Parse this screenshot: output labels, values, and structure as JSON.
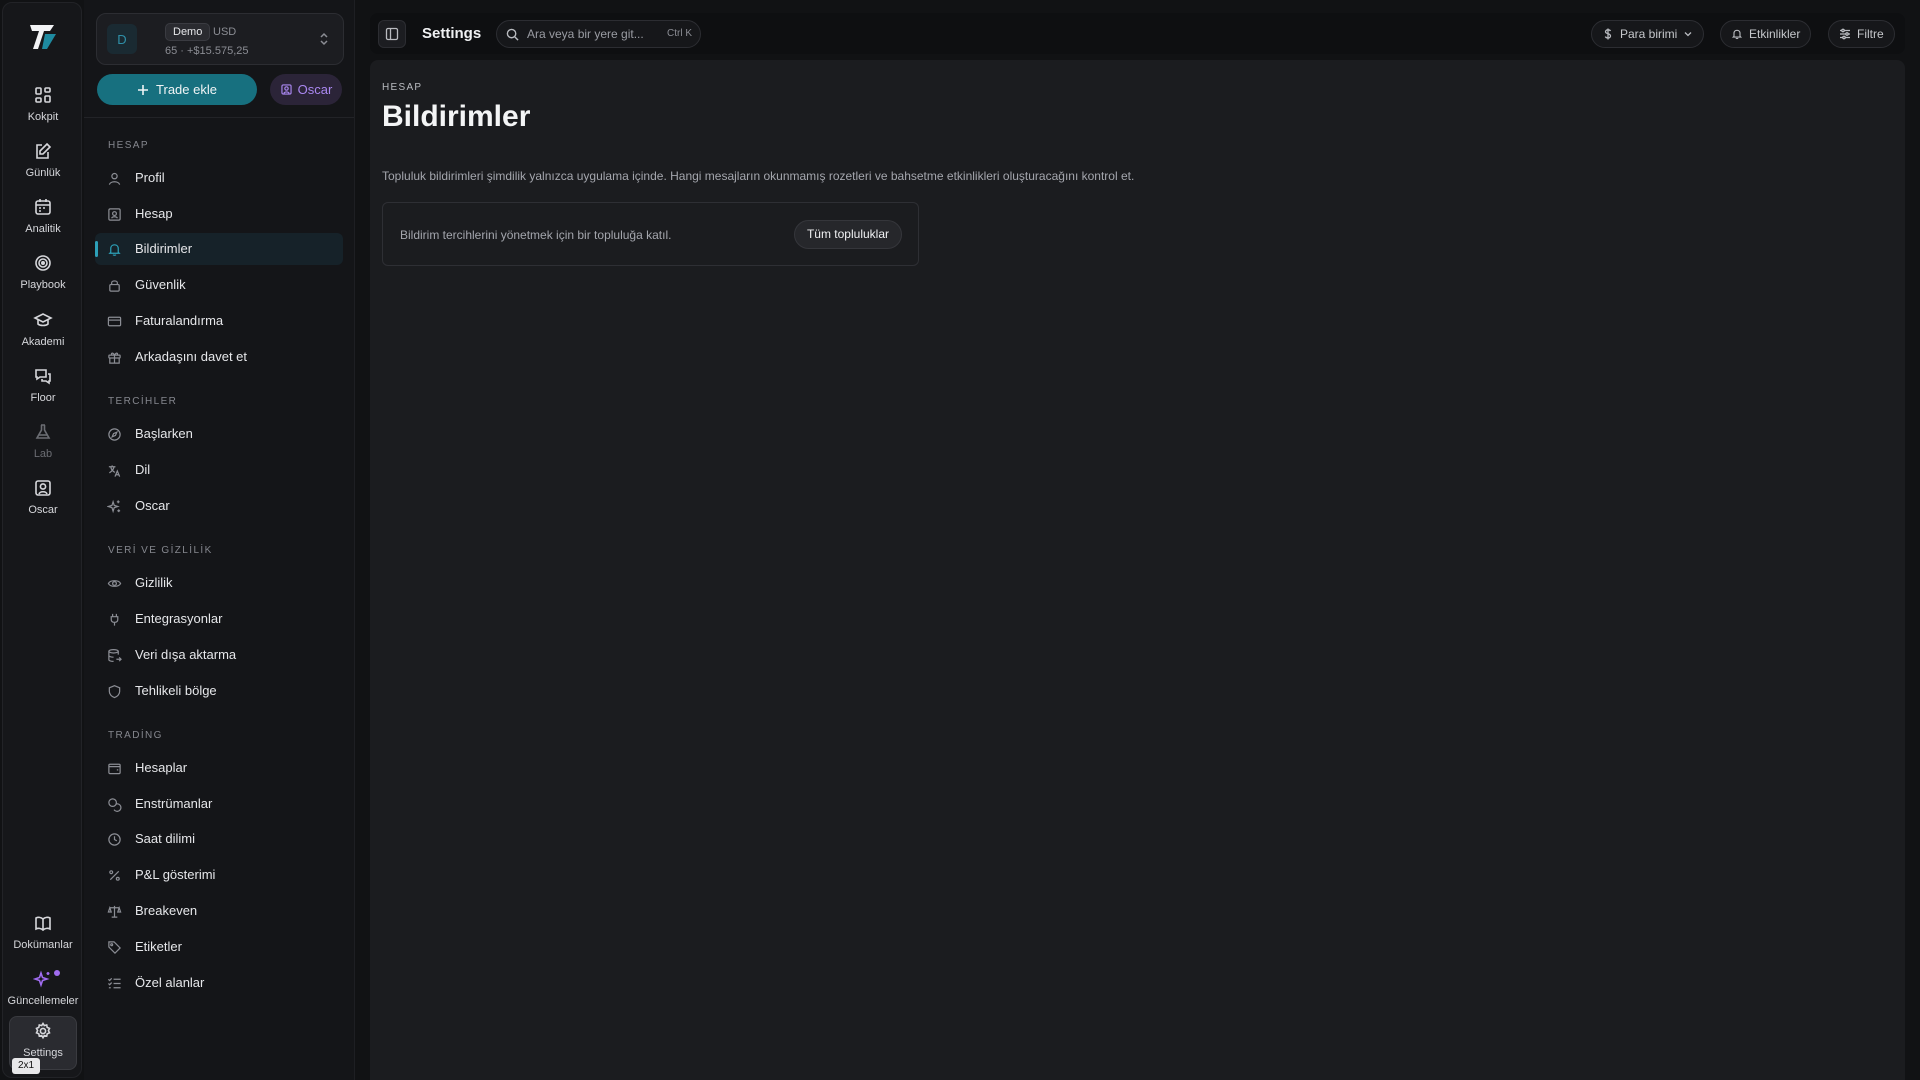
{
  "rail": {
    "items": [
      {
        "label": "Kokpit",
        "icon": "grid-icon"
      },
      {
        "label": "Günlük",
        "icon": "edit-note-icon"
      },
      {
        "label": "Analitik",
        "icon": "calendar-icon"
      },
      {
        "label": "Playbook",
        "icon": "target-icon"
      },
      {
        "label": "Akademi",
        "icon": "graduation-cap-icon"
      },
      {
        "label": "Floor",
        "icon": "chat-icon"
      },
      {
        "label": "Lab",
        "icon": "flask-icon"
      },
      {
        "label": "Oscar",
        "icon": "user-square-icon"
      }
    ],
    "bottom": [
      {
        "label": "Dokümanlar",
        "icon": "book-icon"
      },
      {
        "label": "Güncellemeler",
        "icon": "sparkles-icon"
      },
      {
        "label": "Settings",
        "icon": "gear-icon"
      }
    ],
    "badge": "2x1"
  },
  "account": {
    "avatar": "D",
    "mode": "Demo",
    "currency": "USD",
    "balance": "65 · +$15.575,25"
  },
  "actions": {
    "trade": "Trade ekle",
    "oscar": "Oscar"
  },
  "sidebar": {
    "sections": [
      {
        "title": "HESAP",
        "items": [
          "Profil",
          "Hesap",
          "Bildirimler",
          "Güvenlik",
          "Faturalandırma",
          "Arkadaşını davet et"
        ]
      },
      {
        "title": "TERCİHLER",
        "items": [
          "Başlarken",
          "Dil",
          "Oscar"
        ]
      },
      {
        "title": "VERİ VE GİZLİLİK",
        "items": [
          "Gizlilik",
          "Entegrasyonlar",
          "Veri dışa aktarma",
          "Tehlikeli bölge"
        ]
      },
      {
        "title": "TRADİNG",
        "items": [
          "Hesaplar",
          "Enstrümanlar",
          "Saat dilimi",
          "P&L gösterimi",
          "Breakeven",
          "Etiketler",
          "Özel alanlar"
        ]
      }
    ],
    "active": "Bildirimler"
  },
  "topbar": {
    "title": "Settings",
    "search_placeholder": "Ara veya bir yere git...",
    "shortcut": "Ctrl K",
    "currency": "Para birimi",
    "events": "Etkinlikler",
    "filter": "Filtre"
  },
  "main": {
    "eyebrow": "HESAP",
    "title": "Bildirimler",
    "description": "Topluluk bildirimleri şimdilik yalnızca uygulama içinde. Hangi mesajların okunmamış rozetleri ve bahsetme etkinlikleri oluşturacağını kontrol et.",
    "card_text": "Bildirim tercihlerini yönetmek için bir topluluğa katıl.",
    "card_button": "Tüm topluluklar"
  },
  "colors": {
    "accent": "#17707f",
    "accent_active": "#2da0b8",
    "oscar": "#a987f0"
  }
}
